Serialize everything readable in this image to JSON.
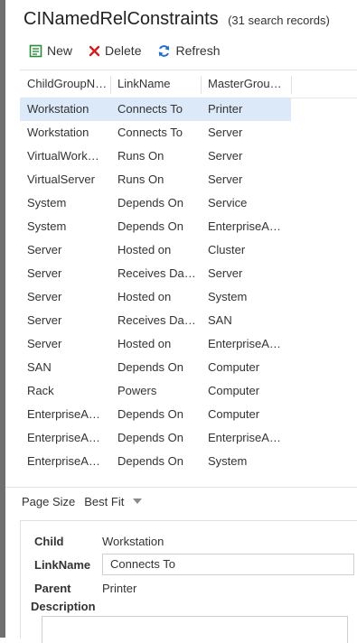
{
  "header": {
    "title": "CINamedRelConstraints",
    "record_count": "(31 search records)"
  },
  "toolbar": {
    "new_label": "New",
    "delete_label": "Delete",
    "refresh_label": "Refresh"
  },
  "colors": {
    "new_icon": "#2e8b3e",
    "delete_icon": "#d11e1e",
    "refresh_icon": "#1f6fc4",
    "selected_row": "#dbe9f9"
  },
  "grid": {
    "headers": [
      "ChildGroupN…",
      "LinkName",
      "MasterGrou…"
    ],
    "rows": [
      [
        "Workstation",
        "Connects To",
        "Printer"
      ],
      [
        "Workstation",
        "Connects To",
        "Server"
      ],
      [
        "VirtualWork…",
        "Runs On",
        "Server"
      ],
      [
        "VirtualServer",
        "Runs On",
        "Server"
      ],
      [
        "System",
        "Depends On",
        "Service"
      ],
      [
        "System",
        "Depends On",
        "EnterpriseA…"
      ],
      [
        "Server",
        "Hosted on",
        "Cluster"
      ],
      [
        "Server",
        "Receives Da…",
        "Server"
      ],
      [
        "Server",
        "Hosted on",
        "System"
      ],
      [
        "Server",
        "Receives Da…",
        "SAN"
      ],
      [
        "Server",
        "Hosted on",
        "EnterpriseA…"
      ],
      [
        "SAN",
        "Depends On",
        "Computer"
      ],
      [
        "Rack",
        "Powers",
        "Computer"
      ],
      [
        "EnterpriseA…",
        "Depends On",
        "Computer"
      ],
      [
        "EnterpriseA…",
        "Depends On",
        "EnterpriseA…"
      ],
      [
        "EnterpriseA…",
        "Depends On",
        "System"
      ]
    ]
  },
  "pager": {
    "label": "Page Size",
    "value": "Best Fit"
  },
  "detail": {
    "child_label": "Child",
    "child_value": "Workstation",
    "linkname_label": "LinkName",
    "linkname_value": "Connects To",
    "parent_label": "Parent",
    "parent_value": "Printer",
    "description_label": "Description"
  }
}
